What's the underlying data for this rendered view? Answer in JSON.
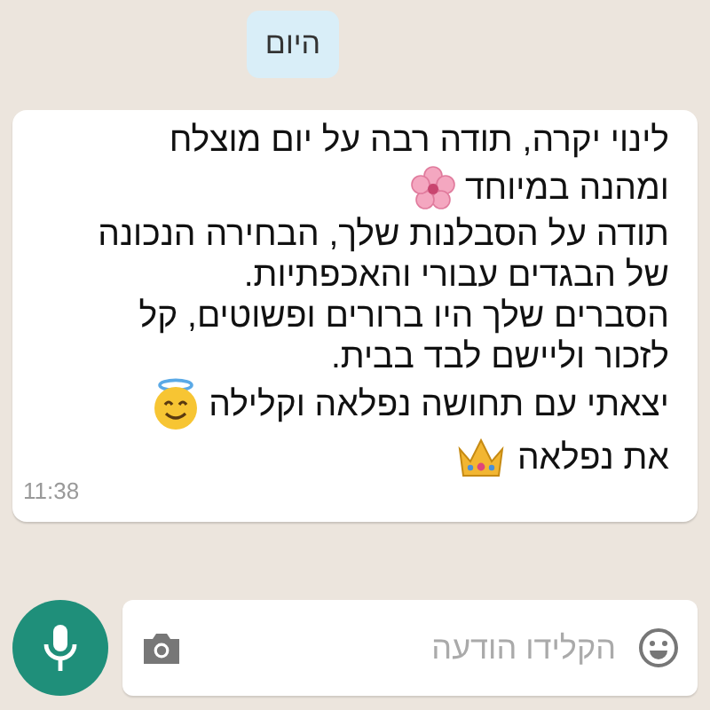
{
  "date_chip": "היום",
  "message": {
    "lines": [
      {
        "text": "לינוי יקרה, תודה רבה על יום מוצלח",
        "kind": "text"
      },
      {
        "text": "ומהנה במיוחד",
        "kind": "flower"
      },
      {
        "text": "תודה על הסבלנות שלך, הבחירה הנכונה",
        "kind": "text"
      },
      {
        "text": "של הבגדים עבורי והאכפתיות.",
        "kind": "text"
      },
      {
        "text": "הסברים שלך היו ברורים ופשוטים, קל",
        "kind": "text"
      },
      {
        "text": "לזכור וליישם לבד בבית.",
        "kind": "text"
      },
      {
        "text": "יצאתי עם תחושה נפלאה וקלילה",
        "kind": "smiley"
      },
      {
        "text": "את נפלאה",
        "kind": "crown"
      }
    ],
    "time": "11:38"
  },
  "composer": {
    "placeholder": "הקלידו הודעה"
  }
}
